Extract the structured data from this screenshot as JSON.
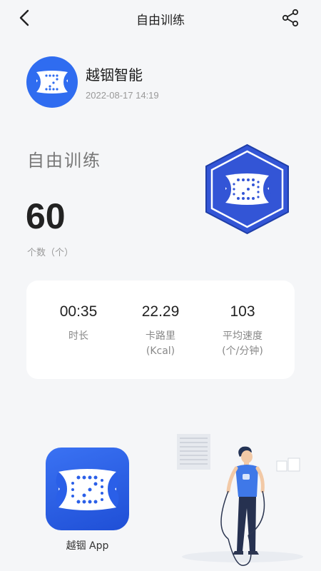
{
  "nav": {
    "title": "自由训练",
    "back_icon": "chevron-left-icon",
    "share_icon": "share-icon"
  },
  "brand": {
    "name": "越铟智能",
    "timestamp": "2022-08-17 14:19"
  },
  "session": {
    "mode": "自由训练",
    "count": "60",
    "count_label": "个数（个）"
  },
  "stats": [
    {
      "value": "00:35",
      "label": "时长"
    },
    {
      "value": "22.29",
      "label": "卡路里\n(Kcal)"
    },
    {
      "value": "103",
      "label": "平均速度\n(个/分钟)"
    }
  ],
  "app": {
    "label": "越铟 App"
  },
  "colors": {
    "accent": "#2f6cf0",
    "badge_blue": "#3355d6",
    "background": "#f5f6f8",
    "card": "#ffffff"
  }
}
